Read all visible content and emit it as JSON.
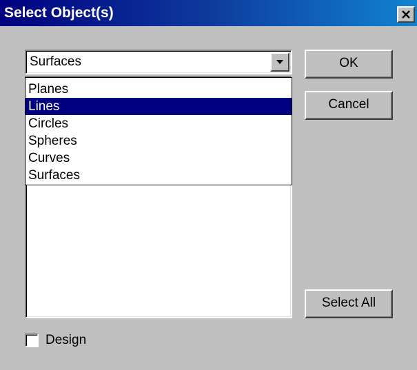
{
  "window": {
    "title": "Select Object(s)",
    "close_icon": "close-icon"
  },
  "combo": {
    "value": "Surfaces",
    "arrow_icon": "chevron-down-icon"
  },
  "dropdown": {
    "items": [
      "Planes",
      "Lines",
      "Circles",
      "Spheres",
      "Curves",
      "Surfaces"
    ],
    "selected": "Lines"
  },
  "buttons": {
    "ok": "OK",
    "cancel": "Cancel",
    "select_all": "Select All"
  },
  "checkbox": {
    "label": "Design",
    "checked": false
  },
  "colors": {
    "title_start": "#000080",
    "title_end": "#1084d0",
    "selection": "#000080",
    "face": "#c0c0c0"
  }
}
